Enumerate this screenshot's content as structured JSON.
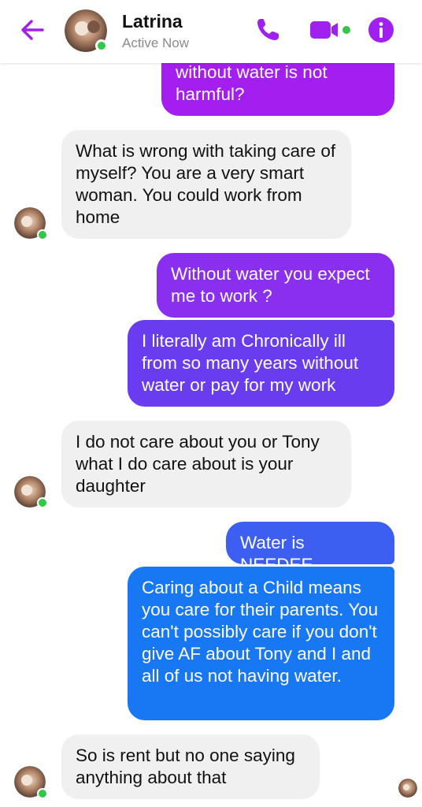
{
  "header": {
    "name": "Latrina",
    "status": "Active Now",
    "icons": {
      "back": "back-arrow-icon",
      "call": "phone-icon",
      "video": "video-camera-icon",
      "info": "info-icon"
    },
    "accent_color": "#a020f0"
  },
  "messages": [
    {
      "from": "me",
      "text": "without water is not harmful?"
    },
    {
      "from": "them",
      "text": "What is wrong with taking care of myself? You are a very smart woman. You could work from home"
    },
    {
      "from": "me",
      "text": "Without water you expect me to work ?"
    },
    {
      "from": "me",
      "text": "I literally am Chronically ill from so many years without water or pay for my work"
    },
    {
      "from": "them",
      "text": "I do not care about you or Tony what I do care about is your daughter"
    },
    {
      "from": "me",
      "text": "Water is NEEDEE"
    },
    {
      "from": "me",
      "text": "Caring about a Child means you care for their parents. You can't possibly care if you don't give AF about Tony and I and all of us not having water."
    },
    {
      "from": "them",
      "text": "So is rent but no one saying anything about that"
    }
  ],
  "colors": {
    "incoming_bubble": "#f0f0f0",
    "outgoing_purple": "#a51ef0",
    "outgoing_violet": "#6a3cf0",
    "outgoing_blue": "#1877f2",
    "online_dot": "#31c84a"
  }
}
